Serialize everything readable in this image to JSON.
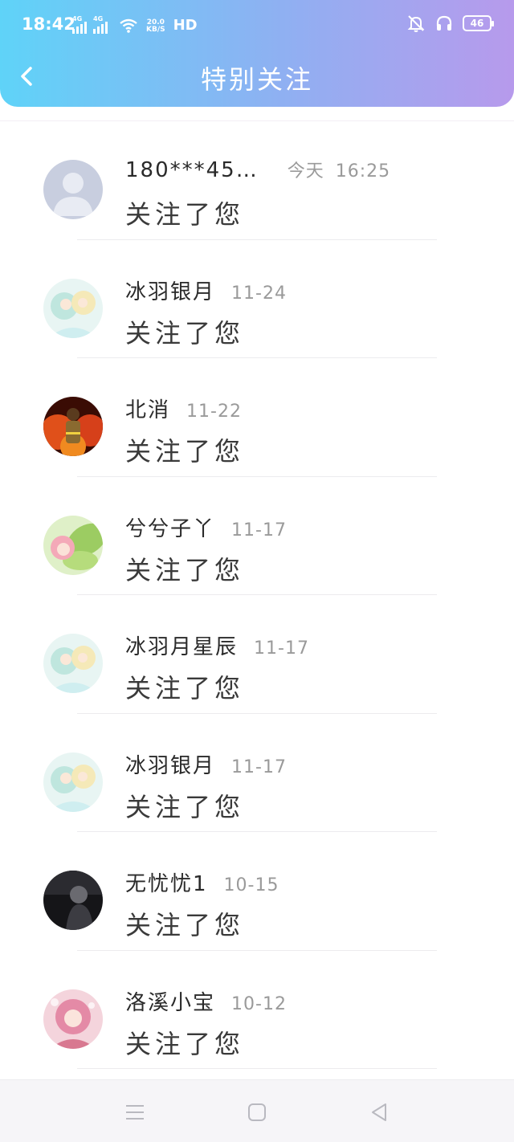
{
  "status_bar": {
    "time": "18:42",
    "network_1": "4G",
    "network_2": "4G",
    "speed_value": "20.0",
    "speed_unit": "KB/S",
    "hd_label": "HD",
    "battery": "46"
  },
  "header": {
    "title": "特别关注",
    "back_icon": "chevron-left-icon"
  },
  "notifications": [
    {
      "name": "180***45…",
      "date_day": "今天",
      "date": "16:25",
      "action": "关注了您",
      "avatar": "default-avatar"
    },
    {
      "name": "冰羽银月",
      "date": "11-24",
      "action": "关注了您",
      "avatar": "anime-avatar"
    },
    {
      "name": "北消",
      "date": "11-22",
      "action": "关注了您",
      "avatar": "firefighter-avatar"
    },
    {
      "name": "兮兮子丫",
      "date": "11-17",
      "action": "关注了您",
      "avatar": "leaf-girl-avatar"
    },
    {
      "name": "冰羽月星辰",
      "date": "11-17",
      "action": "关注了您",
      "avatar": "anime-avatar"
    },
    {
      "name": "冰羽银月",
      "date": "11-17",
      "action": "关注了您",
      "avatar": "anime-avatar"
    },
    {
      "name": "无忧忧1",
      "date": "10-15",
      "action": "关注了您",
      "avatar": "dark-photo-avatar"
    },
    {
      "name": "洛溪小宝",
      "date": "10-12",
      "action": "关注了您",
      "avatar": "pink-anime-avatar"
    }
  ],
  "nav_bar": {
    "menu_icon": "menu-icon",
    "home_icon": "home-icon",
    "back_icon": "back-triangle-icon"
  },
  "colors": {
    "header_gradient_start": "#5fd3f8",
    "header_gradient_end": "#b79aec",
    "name_text": "#2a2a2a",
    "date_text": "#9a9a9a"
  }
}
